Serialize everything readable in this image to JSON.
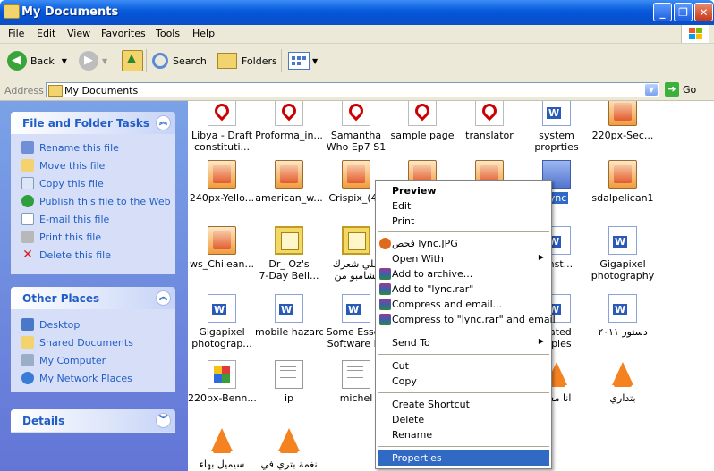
{
  "window": {
    "title": "My Documents"
  },
  "menu": [
    "File",
    "Edit",
    "View",
    "Favorites",
    "Tools",
    "Help"
  ],
  "toolbar": {
    "back": "Back",
    "search": "Search",
    "folders": "Folders"
  },
  "address": {
    "label": "Address",
    "value": "My Documents",
    "go": "Go"
  },
  "left": {
    "tasks": {
      "title": "File and Folder Tasks",
      "items": [
        "Rename this file",
        "Move this file",
        "Copy this file",
        "Publish this file to the Web",
        "E-mail this file",
        "Print this file",
        "Delete this file"
      ]
    },
    "places": {
      "title": "Other Places",
      "items": [
        "Desktop",
        "Shared Documents",
        "My Computer",
        "My Network Places"
      ]
    },
    "details": {
      "title": "Details"
    }
  },
  "files": [
    {
      "name": "Libya - Draft",
      "name2": "constituti...",
      "icon": "pdf"
    },
    {
      "name": "Proforma_in...",
      "name2": "",
      "icon": "pdf"
    },
    {
      "name": "Samantha",
      "name2": "Who Ep7 S1",
      "icon": "pdf"
    },
    {
      "name": "sample page",
      "name2": "",
      "icon": "pdf"
    },
    {
      "name": "translator",
      "name2": "",
      "icon": "pdf"
    },
    {
      "name": "system",
      "name2": "proprties",
      "icon": "doc"
    },
    {
      "name": "220px-Sec...",
      "name2": "",
      "icon": "img"
    },
    {
      "name": "240px-Yello...",
      "name2": "",
      "icon": "img"
    },
    {
      "name": "american_w...",
      "name2": "",
      "icon": "img"
    },
    {
      "name": "Crispix_(47",
      "name2": "",
      "icon": "img"
    },
    {
      "name": "",
      "name2": "",
      "icon": "img"
    },
    {
      "name": "",
      "name2": "",
      "icon": "img"
    },
    {
      "name": "lync",
      "name2": "",
      "icon": "img"
    },
    {
      "name": "sdalpelican1",
      "name2": "",
      "icon": "img"
    },
    {
      "name": "ws_Chilean...",
      "name2": "",
      "icon": "img"
    },
    {
      "name": "Dr_ Oz's",
      "name2": "7-Day Bell...",
      "icon": "book"
    },
    {
      "name": "علي شعرك",
      "name2": "بشامبو من",
      "icon": "book"
    },
    {
      "name": "_Inst...",
      "name2": "",
      "icon": "doc"
    },
    {
      "name": "Gigapixel",
      "name2": "photography",
      "icon": "doc"
    },
    {
      "name": "Gigapixel",
      "name2": "photograp...",
      "icon": "doc"
    },
    {
      "name": "mobile hazards",
      "name2": "",
      "icon": "doc"
    },
    {
      "name": "Some Essen",
      "name2": "Software Fo",
      "icon": "doc"
    },
    {
      "name": "slated",
      "name2": "mples",
      "icon": "doc"
    },
    {
      "name": "دستور ٢٠١١",
      "name2": "",
      "icon": "doc"
    },
    {
      "name": "220px-Benn...",
      "name2": "",
      "icon": "bmp"
    },
    {
      "name": "ip",
      "name2": "",
      "icon": "txt"
    },
    {
      "name": "michel",
      "name2": "",
      "icon": "txt"
    },
    {
      "name": "انا مش",
      "name2": "",
      "icon": "vlc"
    },
    {
      "name": "بتداري",
      "name2": "",
      "icon": "vlc"
    },
    {
      "name": "سيميل بهاء",
      "name2": "",
      "icon": "vlc"
    },
    {
      "name": "نغمة بتري في",
      "name2": "",
      "icon": "vlc"
    }
  ],
  "context_menu": {
    "preview": "Preview",
    "edit": "Edit",
    "print": "Print",
    "open_with_app": "فحص lync.JPG",
    "open_with": "Open With",
    "add_archive": "Add to archive...",
    "add_rar": "Add to \"lync.rar\"",
    "compress_email": "Compress and email...",
    "compress_rar_email": "Compress to \"lync.rar\" and email",
    "send_to": "Send To",
    "cut": "Cut",
    "copy": "Copy",
    "create_shortcut": "Create Shortcut",
    "delete": "Delete",
    "rename": "Rename",
    "properties": "Properties"
  }
}
